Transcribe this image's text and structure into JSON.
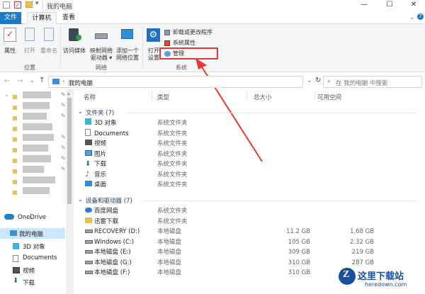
{
  "title": "我的电脑",
  "qat_dropdown": "▾",
  "window_buttons": {
    "minimize": "—",
    "maximize": "☐",
    "close": "✕"
  },
  "tabs": {
    "file": "文件",
    "computer": "计算机",
    "view": "查看"
  },
  "ribbon": {
    "location": {
      "properties": "属性",
      "open": "打开",
      "rename": "重命名",
      "group": "位置"
    },
    "network": {
      "access_media": "访问媒体",
      "map_drive": "映射网络\n驱动器 ▾",
      "add_location": "添加一个\n网络位置",
      "group": "网络"
    },
    "system": {
      "open_settings": "打开\n设置",
      "uninstall": "卸载或更改程序",
      "system_props": "系统属性",
      "manage": "管理",
      "group": "系统"
    }
  },
  "address": {
    "path": "我的电脑",
    "search_placeholder": "在 我的电脑 中搜索"
  },
  "columns": {
    "name": "名称",
    "type": "类型",
    "total": "总大小",
    "free": "可用空间"
  },
  "folders_header": "文件夹 (7)",
  "folders": [
    {
      "name": "3D 对象",
      "type": "系统文件夹",
      "icon": "cube-icon"
    },
    {
      "name": "Documents",
      "type": "系统文件夹",
      "icon": "document-icon"
    },
    {
      "name": "视频",
      "type": "系统文件夹",
      "icon": "video-icon"
    },
    {
      "name": "图片",
      "type": "系统文件夹",
      "icon": "picture-icon"
    },
    {
      "name": "下载",
      "type": "系统文件夹",
      "icon": "download-icon"
    },
    {
      "name": "音乐",
      "type": "系统文件夹",
      "icon": "music-icon"
    },
    {
      "name": "桌面",
      "type": "系统文件夹",
      "icon": "desktop-icon"
    }
  ],
  "drives_header": "设备和驱动器 (7)",
  "drives": [
    {
      "name": "百度网盘",
      "type": "系统文件夹",
      "total": "",
      "free": ""
    },
    {
      "name": "迅雷下载",
      "type": "系统文件夹",
      "total": "",
      "free": ""
    },
    {
      "name": "RECOVERY (D:)",
      "type": "本地磁盘",
      "total": "11.2 GB",
      "free": "1.68 GB"
    },
    {
      "name": "Windows (C:)",
      "type": "本地磁盘",
      "total": "105 GB",
      "free": "2.32 GB"
    },
    {
      "name": "本地磁盘 (E:)",
      "type": "本地磁盘",
      "total": "309 GB",
      "free": "219 GB"
    },
    {
      "name": "本地磁盘 (G:)",
      "type": "本地磁盘",
      "total": "310 GB",
      "free": "287 GB"
    },
    {
      "name": "本地磁盘 (F:)",
      "type": "本地磁盘",
      "total": "310 GB",
      "free": ""
    }
  ],
  "nav": {
    "onedrive": "OneDrive",
    "this_pc": "我的电脑",
    "objects3d": "3D 对象",
    "documents": "Documents",
    "videos": "视频",
    "downloads": "下载"
  },
  "watermark": {
    "title": "这里下载站",
    "url": "heredown.com"
  },
  "colors": {
    "accent": "#1979ca",
    "highlight": "#e53935",
    "selected": "#cce8ff"
  }
}
